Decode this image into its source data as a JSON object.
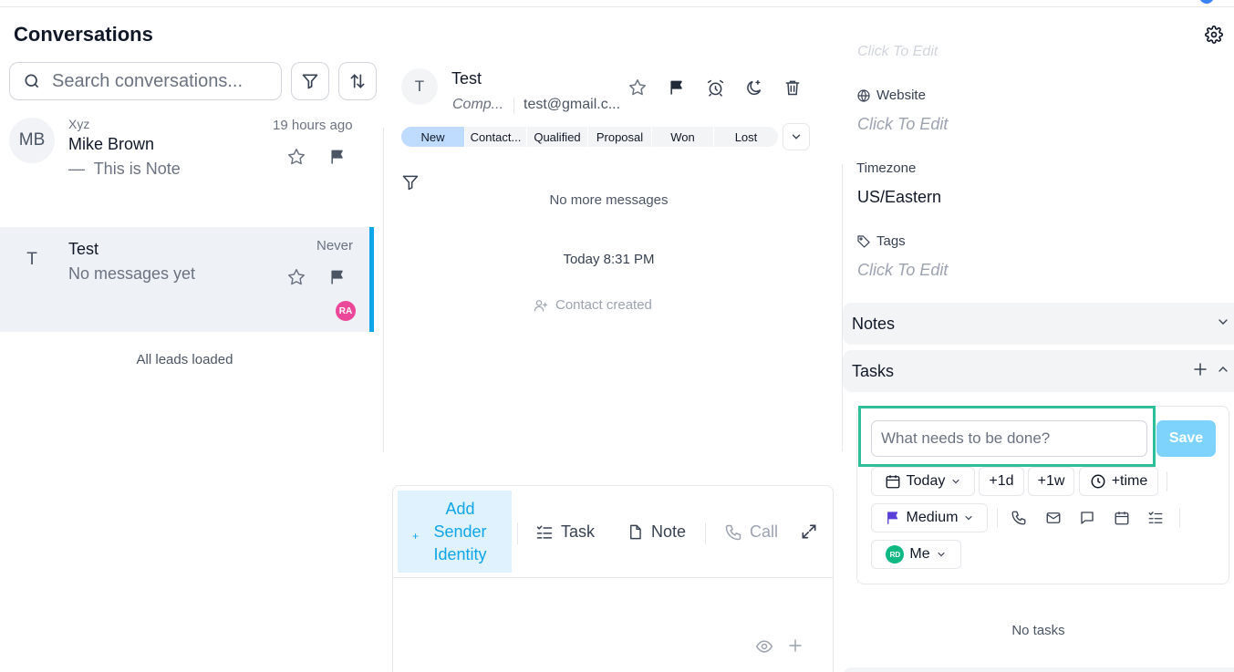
{
  "header": {
    "title": "Conversations"
  },
  "search": {
    "placeholder": "Search conversations..."
  },
  "conversations": [
    {
      "initials": "MB",
      "company": "Xyz",
      "name": "Mike Brown",
      "preview": "This is Note",
      "time": "19 hours ago"
    },
    {
      "initials": "T",
      "name": "Test",
      "preview": "No messages yet",
      "time": "Never",
      "assignee": "RA"
    }
  ],
  "list_footer": "All leads loaded",
  "contact": {
    "initials": "T",
    "name": "Test",
    "company": "Comp...",
    "email": "test@gmail.c..."
  },
  "stages": [
    "New",
    "Contact...",
    "Qualified",
    "Proposal",
    "Won",
    "Lost"
  ],
  "active_stage": "New",
  "messages": {
    "no_more": "No more messages",
    "date": "Today 8:31 PM",
    "event": "Contact created"
  },
  "composer": {
    "sender_label": "Add Sender Identity",
    "sender_plus": "+",
    "task_label": "Task",
    "note_label": "Note",
    "call_label": "Call"
  },
  "details": {
    "faded_text": "Click To Edit",
    "website_label": "Website",
    "website_value": "Click To Edit",
    "timezone_label": "Timezone",
    "timezone_value": "US/Eastern",
    "tags_label": "Tags",
    "tags_value": "Click To Edit"
  },
  "sections": {
    "notes": "Notes",
    "tasks": "Tasks"
  },
  "task_form": {
    "placeholder": "What needs to be done?",
    "save": "Save",
    "date": "Today",
    "plus_day": "+1d",
    "plus_week": "+1w",
    "plus_time": "+time",
    "priority": "Medium",
    "assignee_initials": "RD",
    "assignee": "Me"
  },
  "no_tasks": "No tasks",
  "colors": {
    "accent": "#0ea5e9",
    "highlight_border": "#2dbf9a",
    "priority_flag": "#5b3fd9",
    "active_stage": "#bfdbfe"
  }
}
